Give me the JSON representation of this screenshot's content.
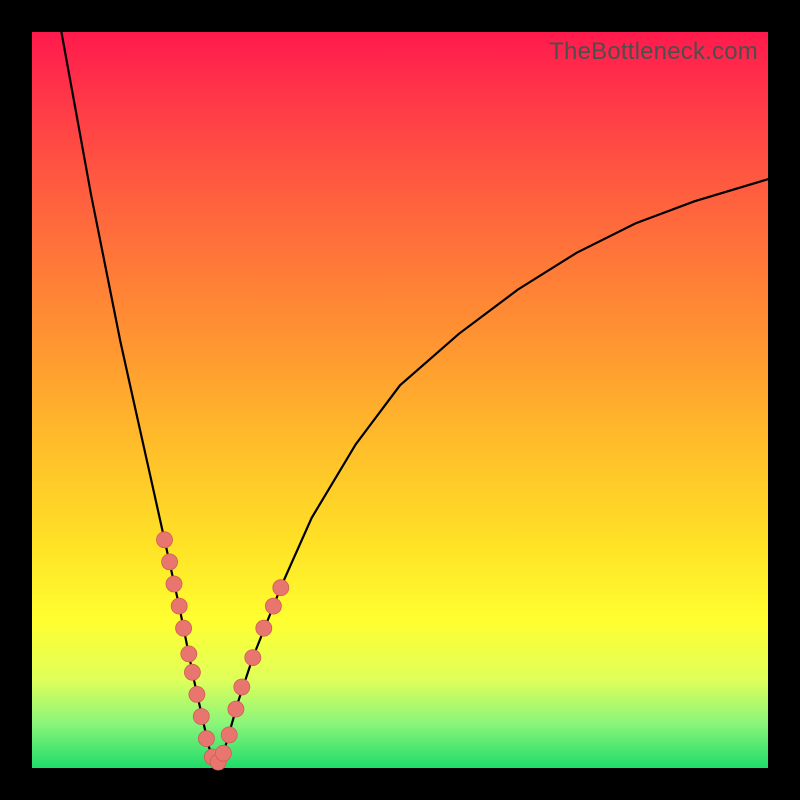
{
  "watermark": "TheBottleneck.com",
  "colors": {
    "dot_fill": "#e9766e",
    "dot_stroke": "#cf5d55",
    "curve": "#000000",
    "frame": "#000000"
  },
  "chart_data": {
    "type": "line",
    "title": "",
    "xlabel": "",
    "ylabel": "",
    "xlim": [
      0,
      100
    ],
    "ylim": [
      0,
      100
    ],
    "notch_x": 25,
    "curve_samples": [
      {
        "x": 4,
        "y": 100
      },
      {
        "x": 6,
        "y": 89
      },
      {
        "x": 8,
        "y": 78
      },
      {
        "x": 10,
        "y": 68
      },
      {
        "x": 12,
        "y": 58
      },
      {
        "x": 14,
        "y": 49
      },
      {
        "x": 16,
        "y": 40
      },
      {
        "x": 18,
        "y": 31
      },
      {
        "x": 20,
        "y": 22
      },
      {
        "x": 22,
        "y": 12
      },
      {
        "x": 24,
        "y": 3
      },
      {
        "x": 25,
        "y": 0
      },
      {
        "x": 26,
        "y": 2
      },
      {
        "x": 28,
        "y": 9
      },
      {
        "x": 30,
        "y": 15
      },
      {
        "x": 34,
        "y": 25
      },
      {
        "x": 38,
        "y": 34
      },
      {
        "x": 44,
        "y": 44
      },
      {
        "x": 50,
        "y": 52
      },
      {
        "x": 58,
        "y": 59
      },
      {
        "x": 66,
        "y": 65
      },
      {
        "x": 74,
        "y": 70
      },
      {
        "x": 82,
        "y": 74
      },
      {
        "x": 90,
        "y": 77
      },
      {
        "x": 100,
        "y": 80
      }
    ],
    "series": [
      {
        "name": "data-points",
        "points": [
          {
            "x": 18,
            "y": 31
          },
          {
            "x": 18.7,
            "y": 28
          },
          {
            "x": 19.3,
            "y": 25
          },
          {
            "x": 20,
            "y": 22
          },
          {
            "x": 20.6,
            "y": 19
          },
          {
            "x": 21.3,
            "y": 15.5
          },
          {
            "x": 21.8,
            "y": 13
          },
          {
            "x": 22.4,
            "y": 10
          },
          {
            "x": 23,
            "y": 7
          },
          {
            "x": 23.7,
            "y": 4
          },
          {
            "x": 24.5,
            "y": 1.5
          },
          {
            "x": 25.3,
            "y": 0.8
          },
          {
            "x": 26,
            "y": 2
          },
          {
            "x": 26.8,
            "y": 4.5
          },
          {
            "x": 27.7,
            "y": 8
          },
          {
            "x": 28.5,
            "y": 11
          },
          {
            "x": 30,
            "y": 15
          },
          {
            "x": 31.5,
            "y": 19
          },
          {
            "x": 32.8,
            "y": 22
          },
          {
            "x": 33.8,
            "y": 24.5
          }
        ]
      }
    ],
    "gradient_stops": [
      {
        "pos": 0,
        "color": "#ff1a4d"
      },
      {
        "pos": 20,
        "color": "#ff5940"
      },
      {
        "pos": 44,
        "color": "#ff9a30"
      },
      {
        "pos": 70,
        "color": "#ffe326"
      },
      {
        "pos": 88,
        "color": "#dfff5a"
      },
      {
        "pos": 100,
        "color": "#1fdc6a"
      }
    ],
    "green_band": {
      "from_y_pct": 93.5,
      "to_y_pct": 100
    }
  }
}
